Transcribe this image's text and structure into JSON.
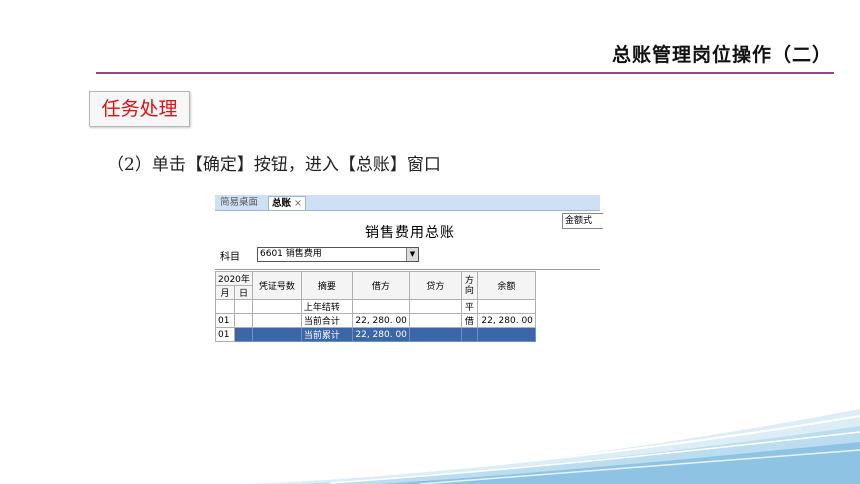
{
  "slide": {
    "title": "总账管理岗位操作（二）",
    "badge": "任务处理",
    "instruction": "（2）单击【确定】按钮，进入【总账】窗口"
  },
  "window": {
    "tabs": {
      "home": "简易桌面",
      "active": "总账",
      "close": "×"
    },
    "view_mode": "金额式",
    "report_title": "销售费用总账",
    "account_label": "科目",
    "account_value": "6601 销售费用",
    "table": {
      "headers": {
        "year": "2020年",
        "month": "月",
        "day": "日",
        "voucher": "凭证号数",
        "summary": "摘要",
        "debit": "借方",
        "credit": "贷方",
        "direction": "方向",
        "balance": "余额"
      },
      "rows": [
        {
          "month": "",
          "day": "",
          "voucher": "",
          "summary": "上年结转",
          "debit": "",
          "credit": "",
          "direction": "平",
          "balance": ""
        },
        {
          "month": "01",
          "day": "",
          "voucher": "",
          "summary": "当前合计",
          "debit": "22, 280. 00",
          "credit": "",
          "direction": "借",
          "balance": "22, 280. 00"
        },
        {
          "month": "01",
          "day": "",
          "voucher": "",
          "summary": "当前累计",
          "debit": "22, 280. 00",
          "credit": "",
          "direction": "",
          "balance": ""
        }
      ]
    }
  },
  "colors": {
    "title_rule": "#8c4a8c",
    "badge_text": "#e01010",
    "selected_row": "#3b66a8"
  }
}
